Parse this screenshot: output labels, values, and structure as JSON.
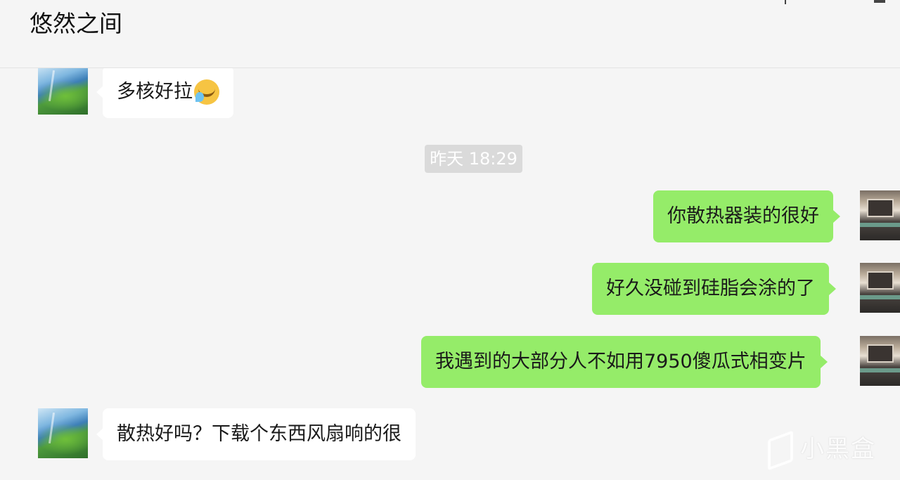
{
  "header": {
    "title": "悠然之间"
  },
  "messages": [
    {
      "side": "in",
      "text": "多核好拉",
      "emoji": "face-with-tears-icon"
    },
    {
      "side": "out",
      "text": "你散热器装的很好"
    },
    {
      "side": "out",
      "text": "好久没碰到硅脂会涂的了"
    },
    {
      "side": "out",
      "text": "我遇到的大部分人不如用7950傻瓜式相变片"
    },
    {
      "side": "in",
      "text": "散热好吗？下载个东西风扇响的很"
    }
  ],
  "timestamp": "昨天 18:29",
  "watermark": {
    "text": "小黑盒",
    "logo": "xiaoheihe-logo-icon"
  },
  "colors": {
    "outgoing_bubble": "#95ec69",
    "incoming_bubble": "#ffffff",
    "background": "#f5f5f5",
    "timestamp_bg": "#dadada"
  }
}
